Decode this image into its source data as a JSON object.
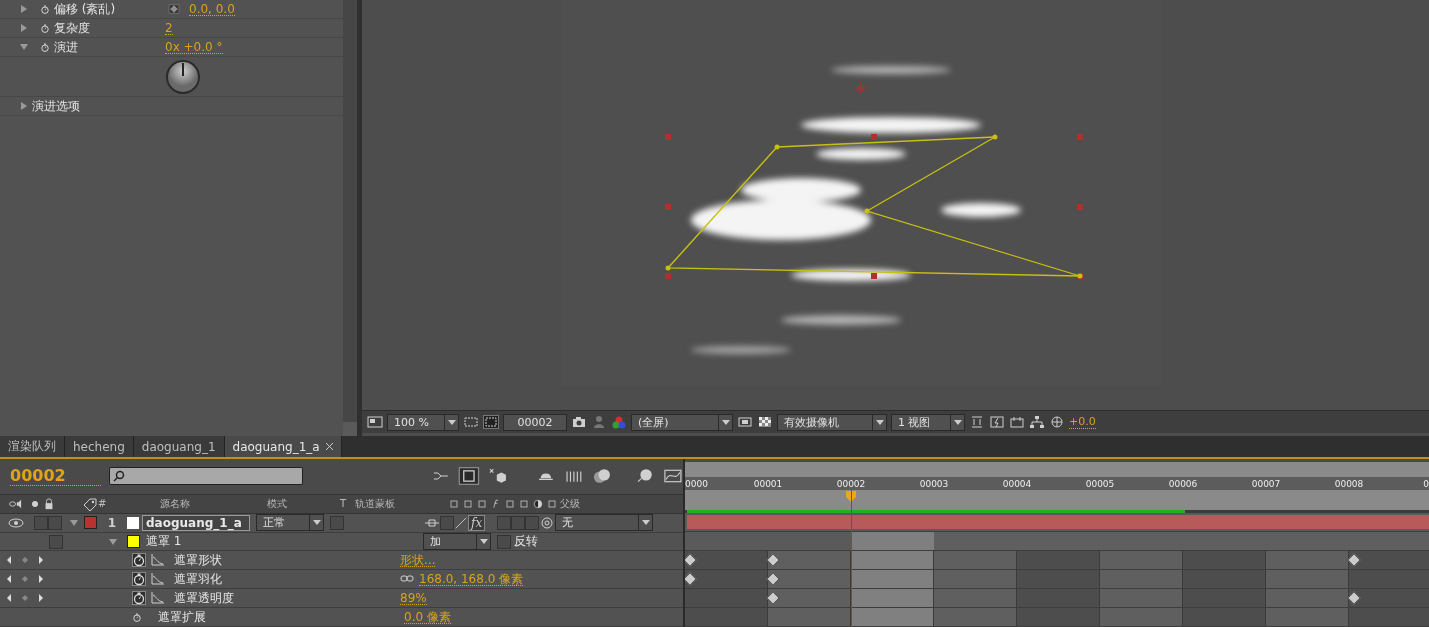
{
  "effect_controls": {
    "rows": [
      {
        "kind": "property",
        "label": "偏移 (紊乱)",
        "value": "0.0, 0.0",
        "expanded": false
      },
      {
        "kind": "property",
        "label": "复杂度",
        "value": "2",
        "expanded": false
      },
      {
        "kind": "property",
        "label": "演进",
        "value": "0x +0.0 °",
        "expanded": true
      },
      {
        "kind": "dial"
      },
      {
        "kind": "group",
        "label": "演进选项",
        "expanded": false
      }
    ]
  },
  "viewer_toolbar": {
    "zoom": "100 %",
    "frame": "00002",
    "resolution": "(全屏)",
    "camera": "有效摄像机",
    "views": "1 视图",
    "exposure": "+0.0"
  },
  "tabs": [
    {
      "label": "渲染队列",
      "selected": false
    },
    {
      "label": "hecheng",
      "selected": false
    },
    {
      "label": "daoguang_1",
      "selected": false
    },
    {
      "label": "daoguang_1_a",
      "selected": true
    }
  ],
  "timeline": {
    "current_time": "00002",
    "columns": [
      "#",
      "源名称",
      "模式",
      "T",
      "轨道蒙板",
      "父级"
    ],
    "ruler": [
      {
        "label": "0000",
        "current": false
      },
      {
        "label": "00001",
        "current": false
      },
      {
        "label": "00002",
        "current": true
      },
      {
        "label": "00003",
        "current": false
      },
      {
        "label": "00004",
        "current": false
      },
      {
        "label": "00005",
        "current": false
      },
      {
        "label": "00006",
        "current": false
      },
      {
        "label": "00007",
        "current": false
      },
      {
        "label": "00008",
        "current": false
      },
      {
        "label": "0",
        "current": false
      }
    ],
    "layers": [
      {
        "number": "1",
        "name": "daoguang_1_a",
        "mode": "正常",
        "parent": "无",
        "effects_switch": "fx",
        "effects_enabled": true,
        "color": "#b83232",
        "visible": true,
        "expanded": true,
        "masks": [
          {
            "name": "遮罩 1",
            "color": "#ffff00",
            "mode": "加",
            "invert_label": "反转",
            "inverted": false,
            "expanded": true,
            "properties": [
              {
                "label": "遮罩形状",
                "value": "形状...",
                "animated": true,
                "linked": false,
                "keyframes": [
                  true,
                  true,
                  false,
                  false,
                  false,
                  false,
                  false,
                  false,
                  true
                ]
              },
              {
                "label": "遮罩羽化",
                "value": "168.0, 168.0 像素",
                "animated": true,
                "linked": true,
                "keyframes": [
                  true,
                  true,
                  false,
                  false,
                  false,
                  false,
                  false,
                  false,
                  false
                ]
              },
              {
                "label": "遮罩透明度",
                "value": "89%",
                "animated": true,
                "linked": false,
                "keyframes": [
                  false,
                  true,
                  false,
                  false,
                  false,
                  false,
                  false,
                  false,
                  true
                ]
              },
              {
                "label": "遮罩扩展",
                "value": "0.0 像素",
                "animated": false,
                "linked": false,
                "keyframes": [
                  false,
                  false,
                  false,
                  false,
                  false,
                  false,
                  false,
                  false,
                  false
                ]
              }
            ]
          }
        ]
      }
    ]
  }
}
